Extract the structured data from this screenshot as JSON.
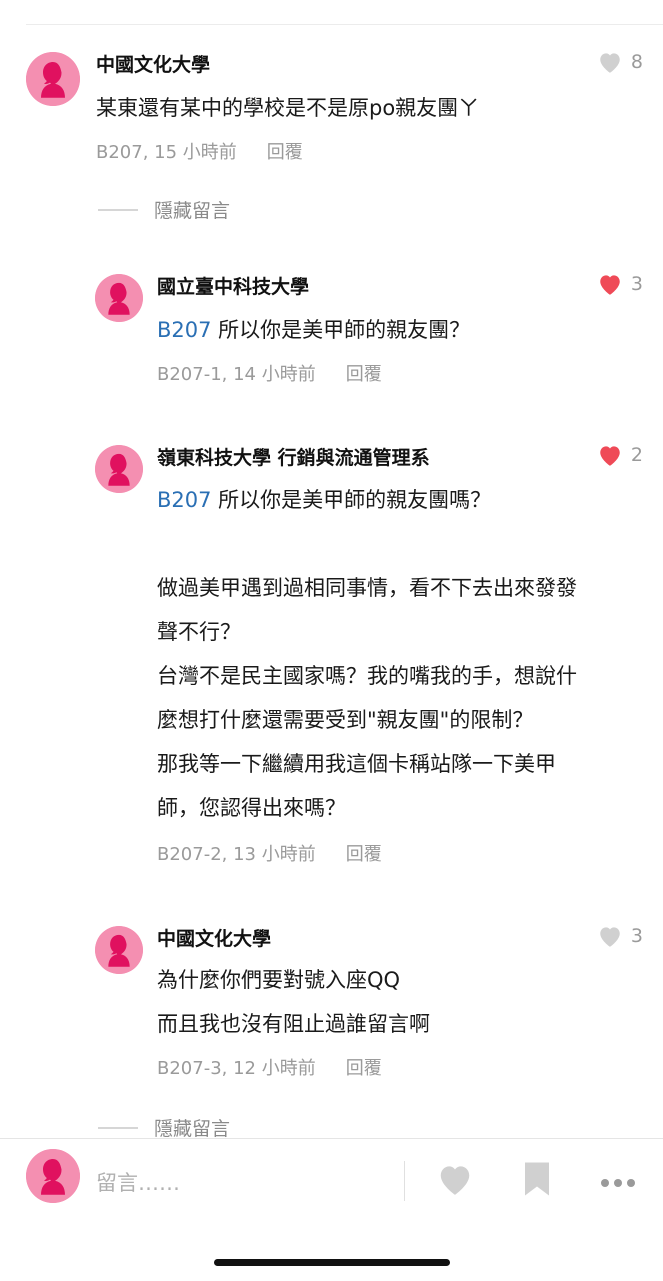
{
  "comments": [
    {
      "author": "中國文化大學",
      "likes": "8",
      "liked": false,
      "lines": [
        "某東還有某中的學校是不是原po親友團ㄚ"
      ],
      "meta": "B207, 15 小時前",
      "reply": "回覆"
    },
    {
      "author": "國立臺中科技大學",
      "likes": "3",
      "liked": true,
      "mention": "B207",
      "lines": [
        " 所以你是美甲師的親友團？"
      ],
      "meta": "B207-1, 14 小時前",
      "reply": "回覆"
    },
    {
      "author": "嶺東科技大學 行銷與流通管理系",
      "likes": "2",
      "liked": true,
      "mention": "B207",
      "lines": [
        " 所以你是美甲師的親友團嗎？",
        "",
        "做過美甲遇到過相同事情，看不下去出來發發",
        "聲不行？",
        "台灣不是民主國家嗎？我的嘴我的手，想說什",
        "麼想打什麼還需要受到\"親友團\"的限制？",
        "那我等一下繼續用我這個卡稱站隊一下美甲",
        "師，您認得出來嗎？"
      ],
      "meta": "B207-2, 13 小時前",
      "reply": "回覆"
    },
    {
      "author": "中國文化大學",
      "likes": "3",
      "liked": false,
      "lines": [
        "為什麼你們要對號入座QQ",
        "而且我也沒有阻止過誰留言啊"
      ],
      "meta": "B207-3, 12 小時前",
      "reply": "回覆"
    }
  ],
  "hide_replies_label": "隱藏留言",
  "composer": {
    "placeholder": "留言……"
  },
  "colors": {
    "liked": "#ef4a57",
    "unliked": "#d0d0d0",
    "mention": "#2a6fb4",
    "avatar": "#f48fb1"
  },
  "icons": [
    "heart-icon",
    "bookmark-icon",
    "more-icon"
  ]
}
